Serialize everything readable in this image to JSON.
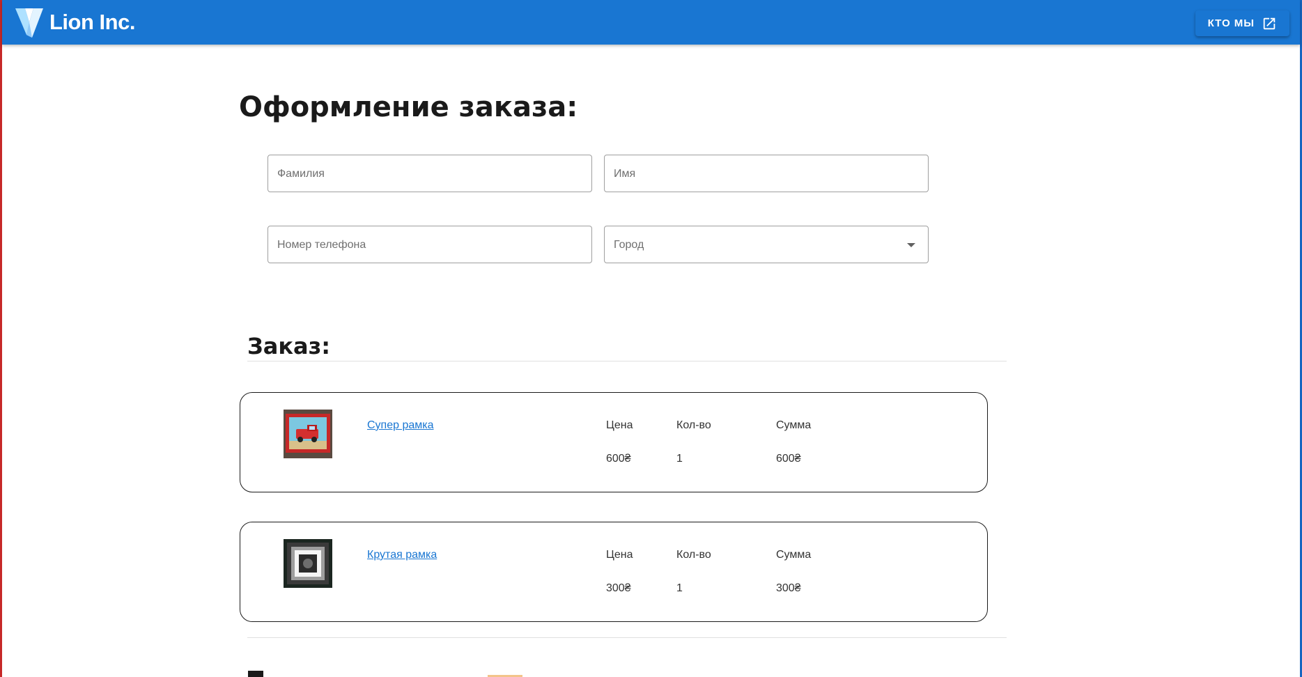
{
  "header": {
    "brand": "Lion Inc.",
    "about_button": "КТО МЫ",
    "color": "#1976d2"
  },
  "page": {
    "title": "Оформление заказа:"
  },
  "form": {
    "last_name_placeholder": "Фамилия",
    "first_name_placeholder": "Имя",
    "phone_placeholder": "Номер телефона",
    "city_placeholder": "Город"
  },
  "order": {
    "title": "Заказ:",
    "items": [
      {
        "name": "Супер рамка",
        "price_label": "Цена",
        "qty_label": "Кол-во",
        "sum_label": "Сумма",
        "price": "600₴",
        "qty": "1",
        "sum": "600₴"
      },
      {
        "name": "Крутая рамка",
        "price_label": "Цена",
        "qty_label": "Кол-во",
        "sum_label": "Сумма",
        "price": "300₴",
        "qty": "1",
        "sum": "300₴"
      }
    ]
  }
}
